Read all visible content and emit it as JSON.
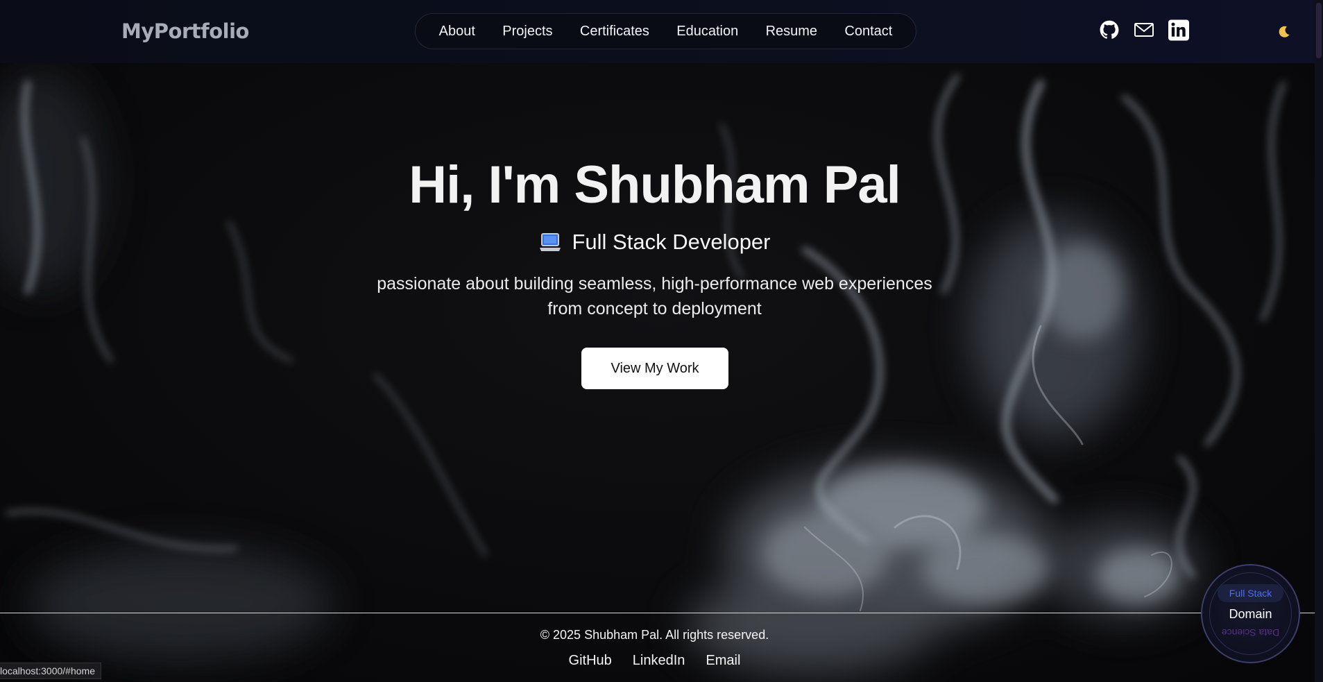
{
  "navbar": {
    "logo": "MyPortfolio",
    "links": [
      "About",
      "Projects",
      "Certificates",
      "Education",
      "Resume",
      "Contact"
    ],
    "social_icons": [
      "github-icon",
      "mail-icon",
      "linkedin-icon"
    ],
    "theme_toggle_icon": "moon-icon"
  },
  "hero": {
    "title": "Hi, I'm Shubham Pal",
    "role_icon": "laptop-icon",
    "role": "Full Stack Developer",
    "description_line1": "passionate about building seamless, high-performance web experiences",
    "description_line2": "from concept to deployment",
    "cta_label": "View My Work"
  },
  "footer": {
    "copyright": "© 2025 Shubham Pal. All rights reserved.",
    "links": [
      "GitHub",
      "LinkedIn",
      "Email"
    ]
  },
  "domain_widget": {
    "active": "Full Stack",
    "label": "Domain",
    "alternate": "Data Science"
  },
  "status_bar": {
    "url": "localhost:3000/#home"
  },
  "colors": {
    "background": "#0c0c10",
    "navbar": "#0b0f1e",
    "cta_bg": "#ffffff",
    "domain_accent": "#4c6ef5",
    "domain_alt": "#5b2f8f"
  }
}
